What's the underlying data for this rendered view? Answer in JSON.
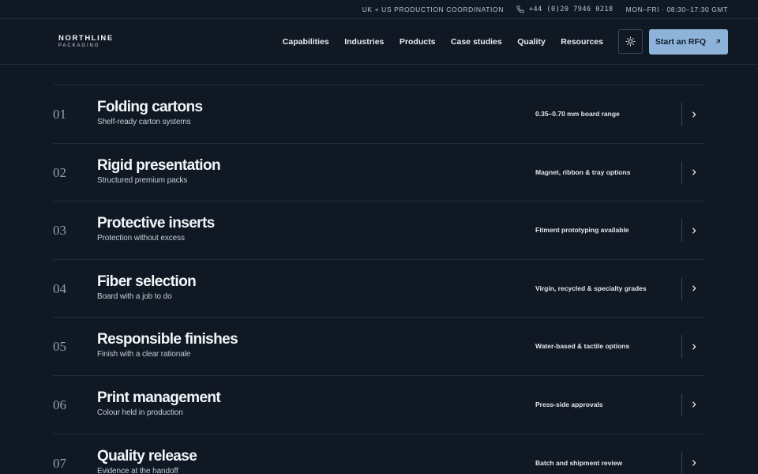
{
  "topbar": {
    "coordination": "UK + US PRODUCTION COORDINATION",
    "phone": "+44 (0)20 7946 0218",
    "hours": "MON–FRI · 08:30–17:30 GMT"
  },
  "brand": {
    "name": "NORTHLINE",
    "tagline": "PACKAGING"
  },
  "nav": {
    "items": [
      "Capabilities",
      "Industries",
      "Products",
      "Case studies",
      "Quality",
      "Resources"
    ],
    "theme_icon": "sun-icon",
    "cta_label": "Start an RFQ",
    "cta_icon": "arrow-up-right-icon"
  },
  "colors": {
    "background": "#101824",
    "accent": "#8db4d8"
  },
  "capabilities": [
    {
      "number": "01",
      "title": "Folding cartons",
      "subtitle": "Shelf-ready carton systems",
      "detail": "0.35–0.70 mm board range"
    },
    {
      "number": "02",
      "title": "Rigid presentation",
      "subtitle": "Structured premium packs",
      "detail": "Magnet, ribbon & tray options"
    },
    {
      "number": "03",
      "title": "Protective inserts",
      "subtitle": "Protection without excess",
      "detail": "Fitment prototyping available"
    },
    {
      "number": "04",
      "title": "Fiber selection",
      "subtitle": "Board with a job to do",
      "detail": "Virgin, recycled & specialty grades"
    },
    {
      "number": "05",
      "title": "Responsible finishes",
      "subtitle": "Finish with a clear rationale",
      "detail": "Water-based & tactile options"
    },
    {
      "number": "06",
      "title": "Print management",
      "subtitle": "Colour held in production",
      "detail": "Press-side approvals"
    },
    {
      "number": "07",
      "title": "Quality release",
      "subtitle": "Evidence at the handoff",
      "detail": "Batch and shipment review"
    }
  ]
}
